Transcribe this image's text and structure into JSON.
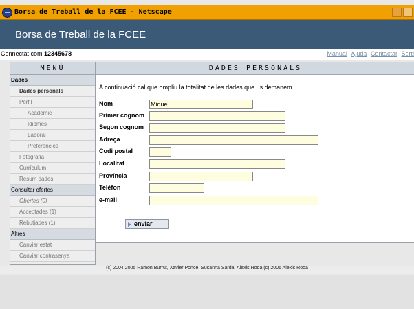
{
  "window": {
    "title": "Borsa de Treball de la FCEE - Netscape"
  },
  "site": {
    "title": "Borsa de Treball de la FCEE"
  },
  "userbar": {
    "connected_prefix": "Connectat com ",
    "user_id": "12345678",
    "links": [
      "Manual",
      "Ajuda",
      "Contactar",
      "Sorti"
    ]
  },
  "menu": {
    "header": "MENÚ",
    "items": [
      {
        "label": "Dades",
        "kind": "section"
      },
      {
        "label": "Dades personals",
        "kind": "l1",
        "active": true
      },
      {
        "label": "Perfil",
        "kind": "l1"
      },
      {
        "label": "Acadèmic",
        "kind": "l2"
      },
      {
        "label": "Idiomes",
        "kind": "l2"
      },
      {
        "label": "Laboral",
        "kind": "l2"
      },
      {
        "label": "Preferencies",
        "kind": "l2"
      },
      {
        "label": "Fotografia",
        "kind": "l1"
      },
      {
        "label": "Currículum",
        "kind": "l1"
      },
      {
        "label": "Resum dades",
        "kind": "l1"
      },
      {
        "label": "Consultar ofertes",
        "kind": "section-plain"
      },
      {
        "label": "Obertes (0)",
        "kind": "l1",
        "italic": true
      },
      {
        "label": "Acceptades (1)",
        "kind": "l1"
      },
      {
        "label": "Rebutjades (1)",
        "kind": "l1"
      },
      {
        "label": "Altres",
        "kind": "section-plain"
      },
      {
        "label": "Canviar estat",
        "kind": "l1"
      },
      {
        "label": "Canviar contrasenya",
        "kind": "l1"
      }
    ]
  },
  "main": {
    "header": "DADES PERSONALS",
    "intro": "A continuació cal que ompliu la totalitat de les dades que us demanem.",
    "fields": {
      "nom": {
        "label": "Nom",
        "value": "Miquel"
      },
      "primer_cognom": {
        "label": "Primer cognom",
        "value": ""
      },
      "segon_cognom": {
        "label": "Segon cognom",
        "value": ""
      },
      "adreca": {
        "label": "Adreça",
        "value": ""
      },
      "codi_postal": {
        "label": "Codi postal",
        "value": ""
      },
      "localitat": {
        "label": "Localitat",
        "value": ""
      },
      "provincia": {
        "label": "Província",
        "value": ""
      },
      "telefon": {
        "label": "Telèfon",
        "value": ""
      },
      "email": {
        "label": "e-mail",
        "value": ""
      }
    },
    "submit_label": "enviar"
  },
  "footer": {
    "text": "(c) 2004,2005 Ramon Burrut, Xavier Ponce, Susanna Sarda, Alexis Roda (c) 2006 Alexis Roda"
  }
}
